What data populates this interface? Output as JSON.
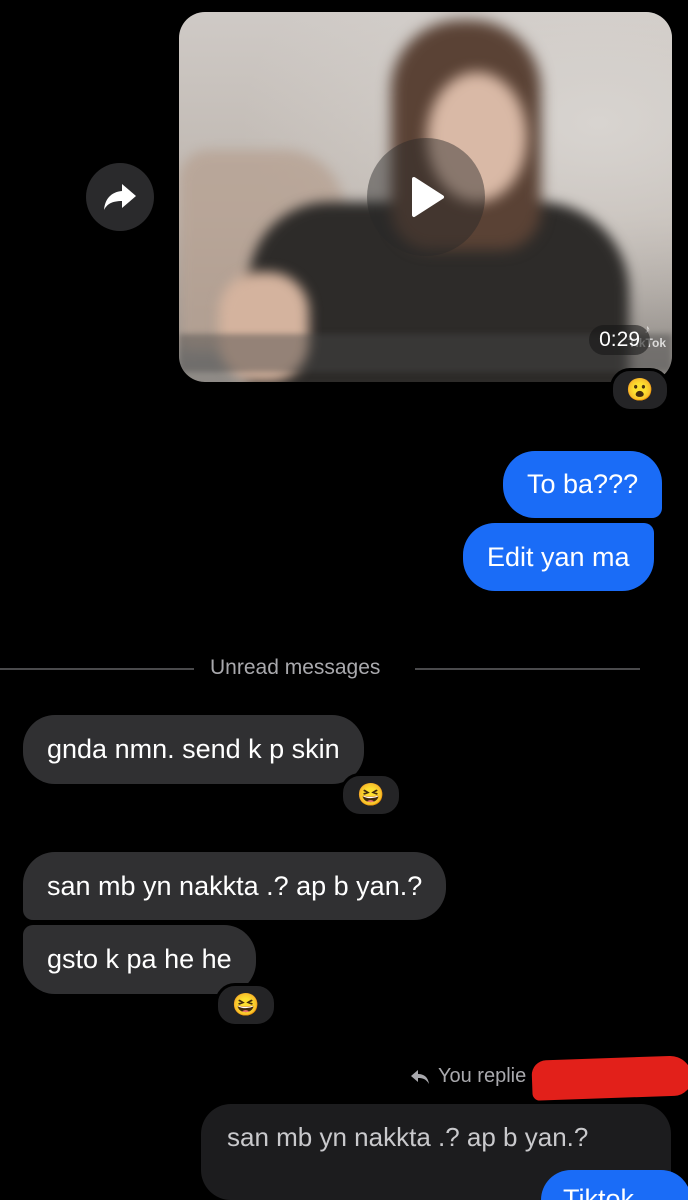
{
  "video_message": {
    "duration": "0:29",
    "watermark": "TikTok",
    "reaction": "😮"
  },
  "outgoing": [
    {
      "text": "To ba???"
    },
    {
      "text": "Edit yan ma"
    }
  ],
  "divider": {
    "label": "Unread messages"
  },
  "incoming": [
    {
      "text": "gnda nmn. send k p skin",
      "reaction": "😆"
    },
    {
      "text": "san mb yn nakkta .? ap b yan.?"
    },
    {
      "text": "gsto k pa he he",
      "reaction": "😆"
    }
  ],
  "reply": {
    "label": "You replie",
    "quoted_text": "san mb yn nakkta .? ap b yan.?",
    "partial_message": "Tiktok"
  }
}
